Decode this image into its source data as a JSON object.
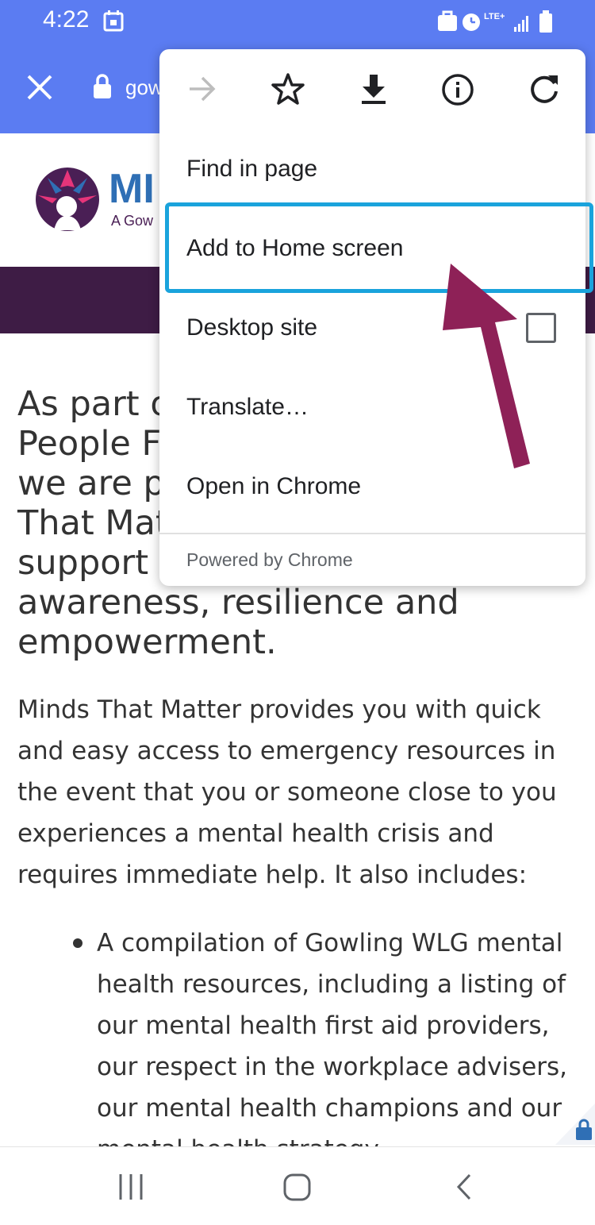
{
  "status_bar": {
    "time": "4:22"
  },
  "toolbar": {
    "url_text": "gow"
  },
  "site": {
    "logo_text": "MI",
    "logo_sub": "A Gow",
    "lead_lines": [
      "As part of",
      "People Fi",
      "we are pl",
      "That Matt",
      "support y",
      "awareness, resilience and",
      "empowerment."
    ],
    "paragraph_lines": [
      "Minds That Matter provides you with quick",
      "and easy access to emergency resources in",
      "the event that you or someone close to you",
      "experiences a mental health crisis and",
      "requires immediate help. It also includes:"
    ],
    "bullet_lines": [
      "A compilation of Gowling WLG mental",
      "health resources, including a listing of",
      "our mental health first aid providers,",
      "our respect in the workplace advisers,",
      "our mental health champions and our",
      "mental health strategy."
    ]
  },
  "menu": {
    "icons": [
      "forward-arrow-icon",
      "star-icon",
      "download-icon",
      "info-icon",
      "refresh-icon"
    ],
    "items": [
      "Find in page",
      "Add to Home screen",
      "Desktop site",
      "Translate…",
      "Open in Chrome"
    ],
    "desktop_site_checked": false,
    "footer": "Powered by Chrome"
  },
  "colors": {
    "toolbar": "#5b7cf2",
    "band": "#3e1c45",
    "highlight": "#1aa3dc",
    "arrow": "#8e2157"
  }
}
